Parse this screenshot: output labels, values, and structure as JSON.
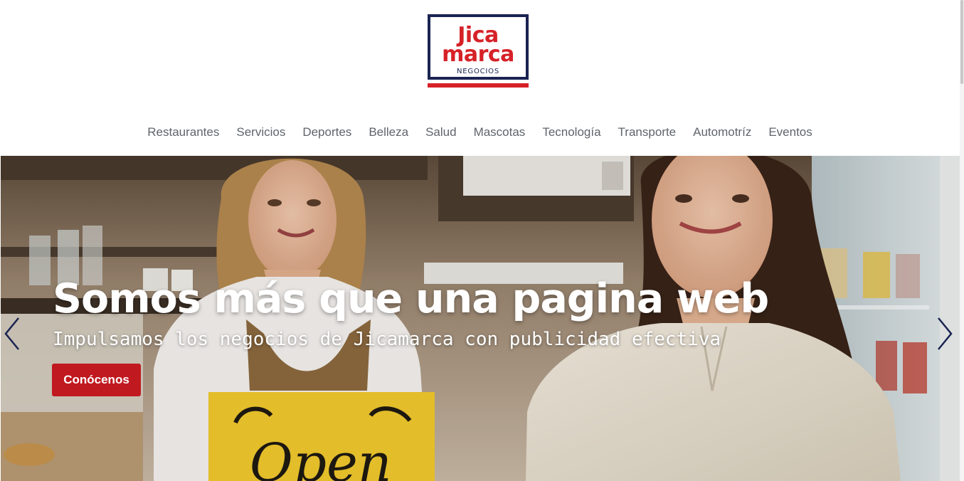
{
  "brand": {
    "word1": "Jica",
    "word2": "marca",
    "sub": "NEGOCIOS",
    "navy": "#1a2352",
    "red": "#d62128"
  },
  "nav": {
    "items": [
      {
        "label": "Restaurantes"
      },
      {
        "label": "Servicios"
      },
      {
        "label": "Deportes"
      },
      {
        "label": "Belleza"
      },
      {
        "label": "Salud"
      },
      {
        "label": "Mascotas"
      },
      {
        "label": "Tecnología"
      },
      {
        "label": "Transporte"
      },
      {
        "label": "Automotríz"
      },
      {
        "label": "Eventos"
      }
    ]
  },
  "hero": {
    "title": "Somos más que una pagina web",
    "subtitle": "Impulsamos los negocios de Jicamarca con publicidad efectiva",
    "button_label": "Conócenos",
    "button_color": "#c0191f",
    "sign_text": "Open",
    "prev_icon": "chevron-left-icon",
    "next_icon": "chevron-right-icon",
    "arrow_color": "#1a2352"
  }
}
